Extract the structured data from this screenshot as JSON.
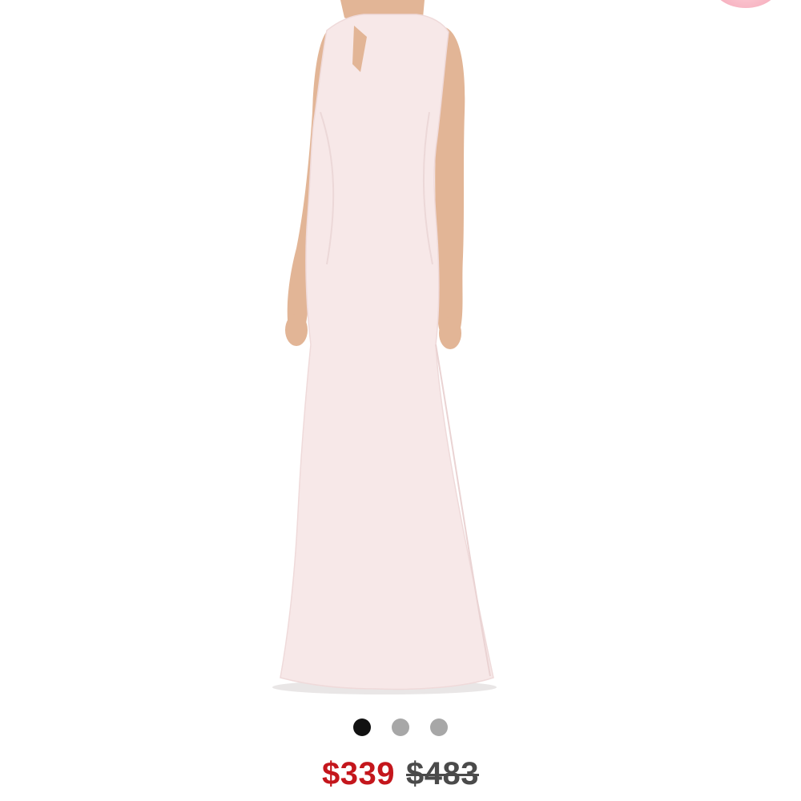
{
  "product": {
    "image_icon": "dress-photo",
    "image_count": 3,
    "active_image_index": 0
  },
  "pricing": {
    "sale_price": "$339",
    "original_price": "$483",
    "sale_color": "#c4161c",
    "original_color": "#4a4a4a"
  },
  "colors": {
    "dress": "#f7e8e8",
    "skin": "#e2b596",
    "dot_active": "#111111",
    "dot_inactive": "#a7a7a7",
    "badge": "#f7b4c2"
  }
}
